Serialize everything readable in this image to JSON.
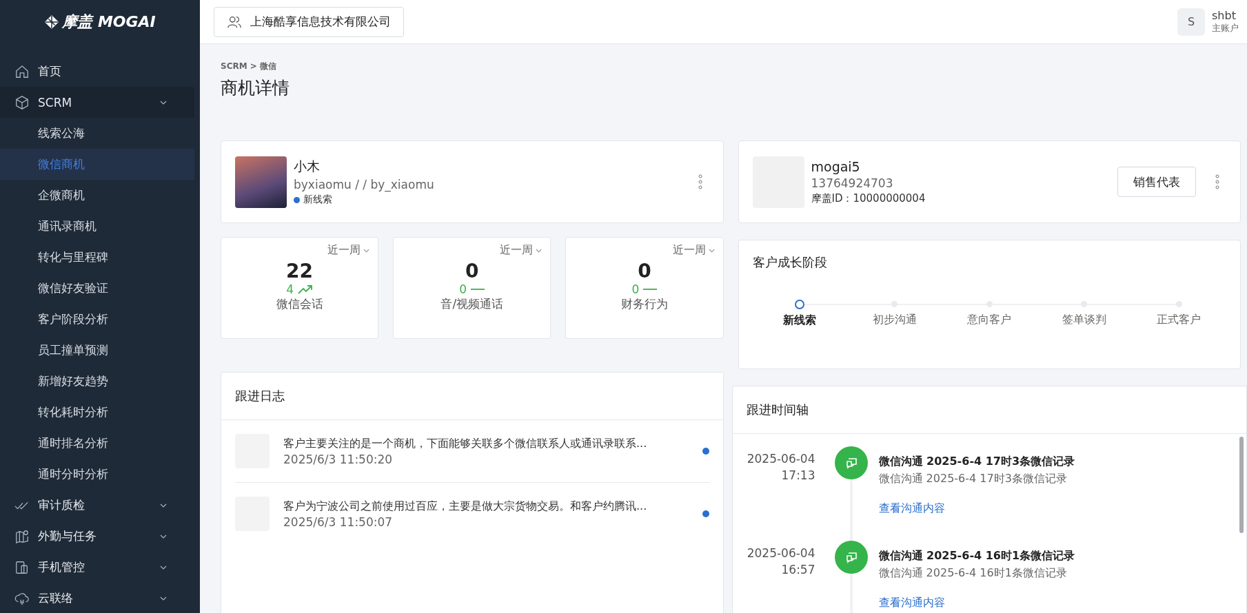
{
  "sidebar": {
    "logo": "摩盖 MOGAI",
    "items": [
      {
        "label": "首页",
        "selected": false
      },
      {
        "label": "SCRM",
        "selected": false,
        "children": [
          {
            "label": "线索公海",
            "selected": false
          },
          {
            "label": "微信商机",
            "selected": true
          },
          {
            "label": "企微商机",
            "selected": false
          },
          {
            "label": "通讯录商机",
            "selected": false
          },
          {
            "label": "转化与里程碑",
            "selected": false
          },
          {
            "label": "微信好友验证",
            "selected": false
          },
          {
            "label": "客户阶段分析",
            "selected": false
          },
          {
            "label": "员工撞单预测",
            "selected": false
          },
          {
            "label": "新增好友趋势",
            "selected": false
          },
          {
            "label": "转化耗时分析",
            "selected": false
          },
          {
            "label": "通时排名分析",
            "selected": false
          },
          {
            "label": "通时分时分析",
            "selected": false
          }
        ]
      },
      {
        "label": "审计质检",
        "selected": false
      },
      {
        "label": "外勤与任务",
        "selected": false
      },
      {
        "label": "手机管控",
        "selected": false
      },
      {
        "label": "云联络",
        "selected": false
      }
    ]
  },
  "topbar": {
    "company": "上海酷享信息技术有限公司",
    "user": {
      "initial": "S",
      "name": "shbt",
      "role": "主账户"
    }
  },
  "breadcrumb": "SCRM > 微信",
  "page_title": "商机详情",
  "contact": {
    "name": "小木",
    "handle": "byxiaomu / / by_xiaomu",
    "status": "新线索"
  },
  "owner": {
    "name": "mogai5",
    "phone": "13764924703",
    "id_label": "摩盖ID：10000000004",
    "role_button": "销售代表"
  },
  "stats": [
    {
      "period": "近一周",
      "value": "22",
      "delta": "4",
      "kind": "up",
      "label": "微信会话"
    },
    {
      "period": "近一周",
      "value": "0",
      "delta": "0",
      "kind": "flat",
      "label": "音/视频通话"
    },
    {
      "period": "近一周",
      "value": "0",
      "delta": "0",
      "kind": "flat",
      "label": "财务行为"
    }
  ],
  "growth": {
    "title": "客户成长阶段",
    "stages": [
      {
        "label": "新线索",
        "selected": true
      },
      {
        "label": "初步沟通",
        "selected": false
      },
      {
        "label": "意向客户",
        "selected": false
      },
      {
        "label": "签单谈判",
        "selected": false
      },
      {
        "label": "正式客户",
        "selected": false
      }
    ]
  },
  "log": {
    "title": "跟进日志",
    "entries": [
      {
        "text": "客户主要关注的是一个商机，下面能够关联多个微信联系人或通讯录联系...",
        "time": "2025/6/3 11:50:20",
        "unread": true
      },
      {
        "text": "客户为宁波公司之前使用过百应，主要是做大宗货物交易。和客户约腾讯...",
        "time": "2025/6/3 11:50:07",
        "unread": true
      }
    ]
  },
  "timeline": {
    "title": "跟进时间轴",
    "events": [
      {
        "date": "2025-06-04",
        "time": "17:13",
        "title": "微信沟通 2025-6-4 17时3条微信记录",
        "subtitle": "微信沟通 2025-6-4 17时3条微信记录",
        "link": "查看沟通内容"
      },
      {
        "date": "2025-06-04",
        "time": "16:57",
        "title": "微信沟通 2025-6-4 16时1条微信记录",
        "subtitle": "微信沟通 2025-6-4 16时1条微信记录",
        "link": "查看沟通内容"
      }
    ]
  }
}
